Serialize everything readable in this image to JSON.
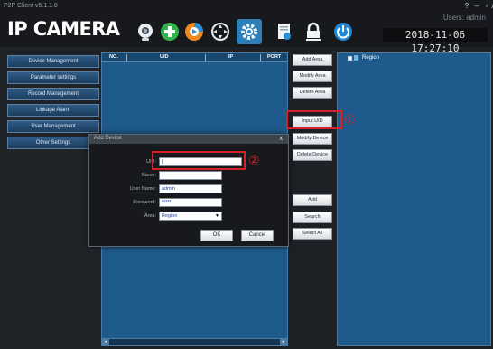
{
  "app": {
    "version": "P2P Client v5.1.1.0",
    "brand": "IP CAMERA",
    "users_label": "Users: admin",
    "datetime": "2018-11-06 17:27:10",
    "window_controls": [
      "?",
      "–",
      "▫",
      "x"
    ]
  },
  "toolbar": {
    "icons": [
      "camera-icon",
      "add-icon",
      "playback-icon",
      "ptz-icon",
      "settings-icon",
      "record-icon",
      "lock-icon",
      "power-icon"
    ],
    "active": "settings-icon"
  },
  "sidebar": {
    "items": [
      {
        "label": "Device Management"
      },
      {
        "label": "Parameter settings"
      },
      {
        "label": "Record Management"
      },
      {
        "label": "Linkage Alarm"
      },
      {
        "label": "User Management"
      },
      {
        "label": "Other Settings"
      }
    ]
  },
  "device_list": {
    "columns": [
      "NO.",
      "UID",
      "IP",
      "PORT"
    ]
  },
  "actions": {
    "add_area": "Add Area",
    "modify_area": "Modify Area",
    "delete_area": "Delete Area",
    "input_uid": "Input UID",
    "modify_device": "Modify Device",
    "delete_device": "Delete Device",
    "add": "Add",
    "search": "Search",
    "select_all": "Select All"
  },
  "tree": {
    "root_label": "Region"
  },
  "dialog": {
    "title": "Add Device",
    "close": "x",
    "fields": {
      "uid_label": "UID:",
      "uid_value": "|",
      "name_label": "Name:",
      "name_value": "",
      "username_label": "User Name:",
      "username_value": "admin",
      "password_label": "Password:",
      "password_value": "*****",
      "area_label": "Area:",
      "area_value": "Region"
    },
    "ok": "OK",
    "cancel": "Cancel"
  },
  "annotations": {
    "marker_1": "①",
    "marker_2": "②",
    "color": "#d8202a"
  },
  "colors": {
    "panel_blue": "#1e5a8b",
    "accent": "#2d7fb8",
    "background": "#1d2126"
  }
}
